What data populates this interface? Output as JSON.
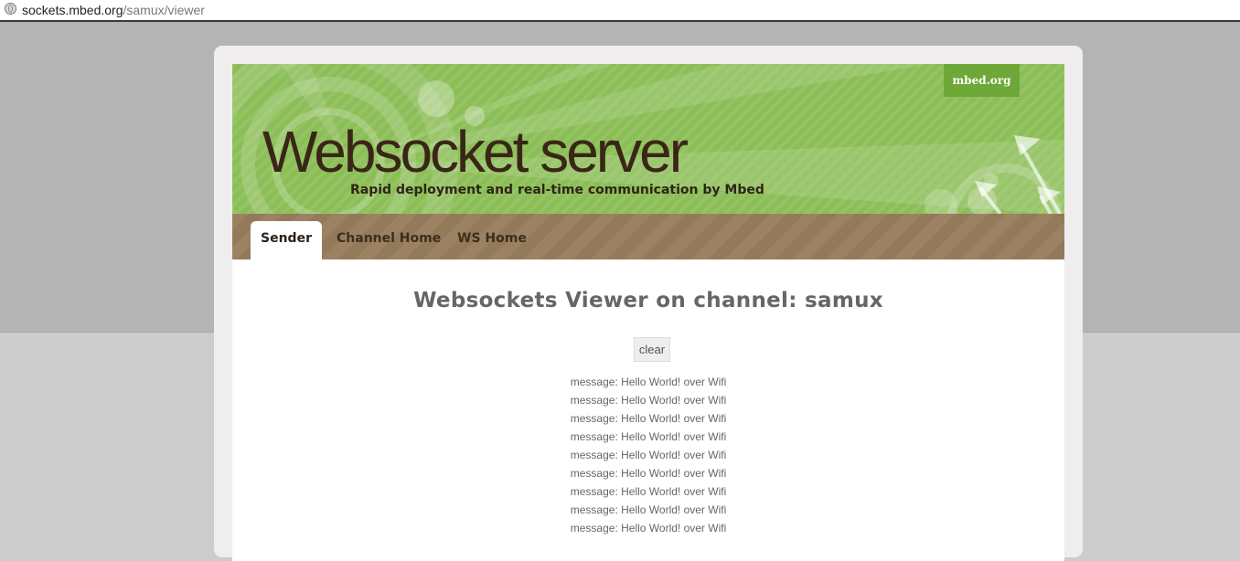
{
  "browser": {
    "url_host": "sockets.mbed.org",
    "url_path": "/samux/viewer"
  },
  "header": {
    "link_label": "mbed.org",
    "title": "Websocket server",
    "tagline": "Rapid deployment and real-time communication by Mbed"
  },
  "nav": {
    "tabs": [
      {
        "label": "Sender",
        "active": true
      },
      {
        "label": "Channel Home",
        "active": false
      },
      {
        "label": "WS Home",
        "active": false
      }
    ]
  },
  "main": {
    "title": "Websockets Viewer on channel: samux",
    "clear_label": "clear",
    "messages": [
      "message: Hello World! over Wifi",
      "message: Hello World! over Wifi",
      "message: Hello World! over Wifi",
      "message: Hello World! over Wifi",
      "message: Hello World! over Wifi",
      "message: Hello World! over Wifi",
      "message: Hello World! over Wifi",
      "message: Hello World! over Wifi",
      "message: Hello World! over Wifi"
    ]
  },
  "colors": {
    "header_green": "#8cbe58",
    "nav_brown": "#9c8262",
    "title_brown": "#3a2617"
  }
}
